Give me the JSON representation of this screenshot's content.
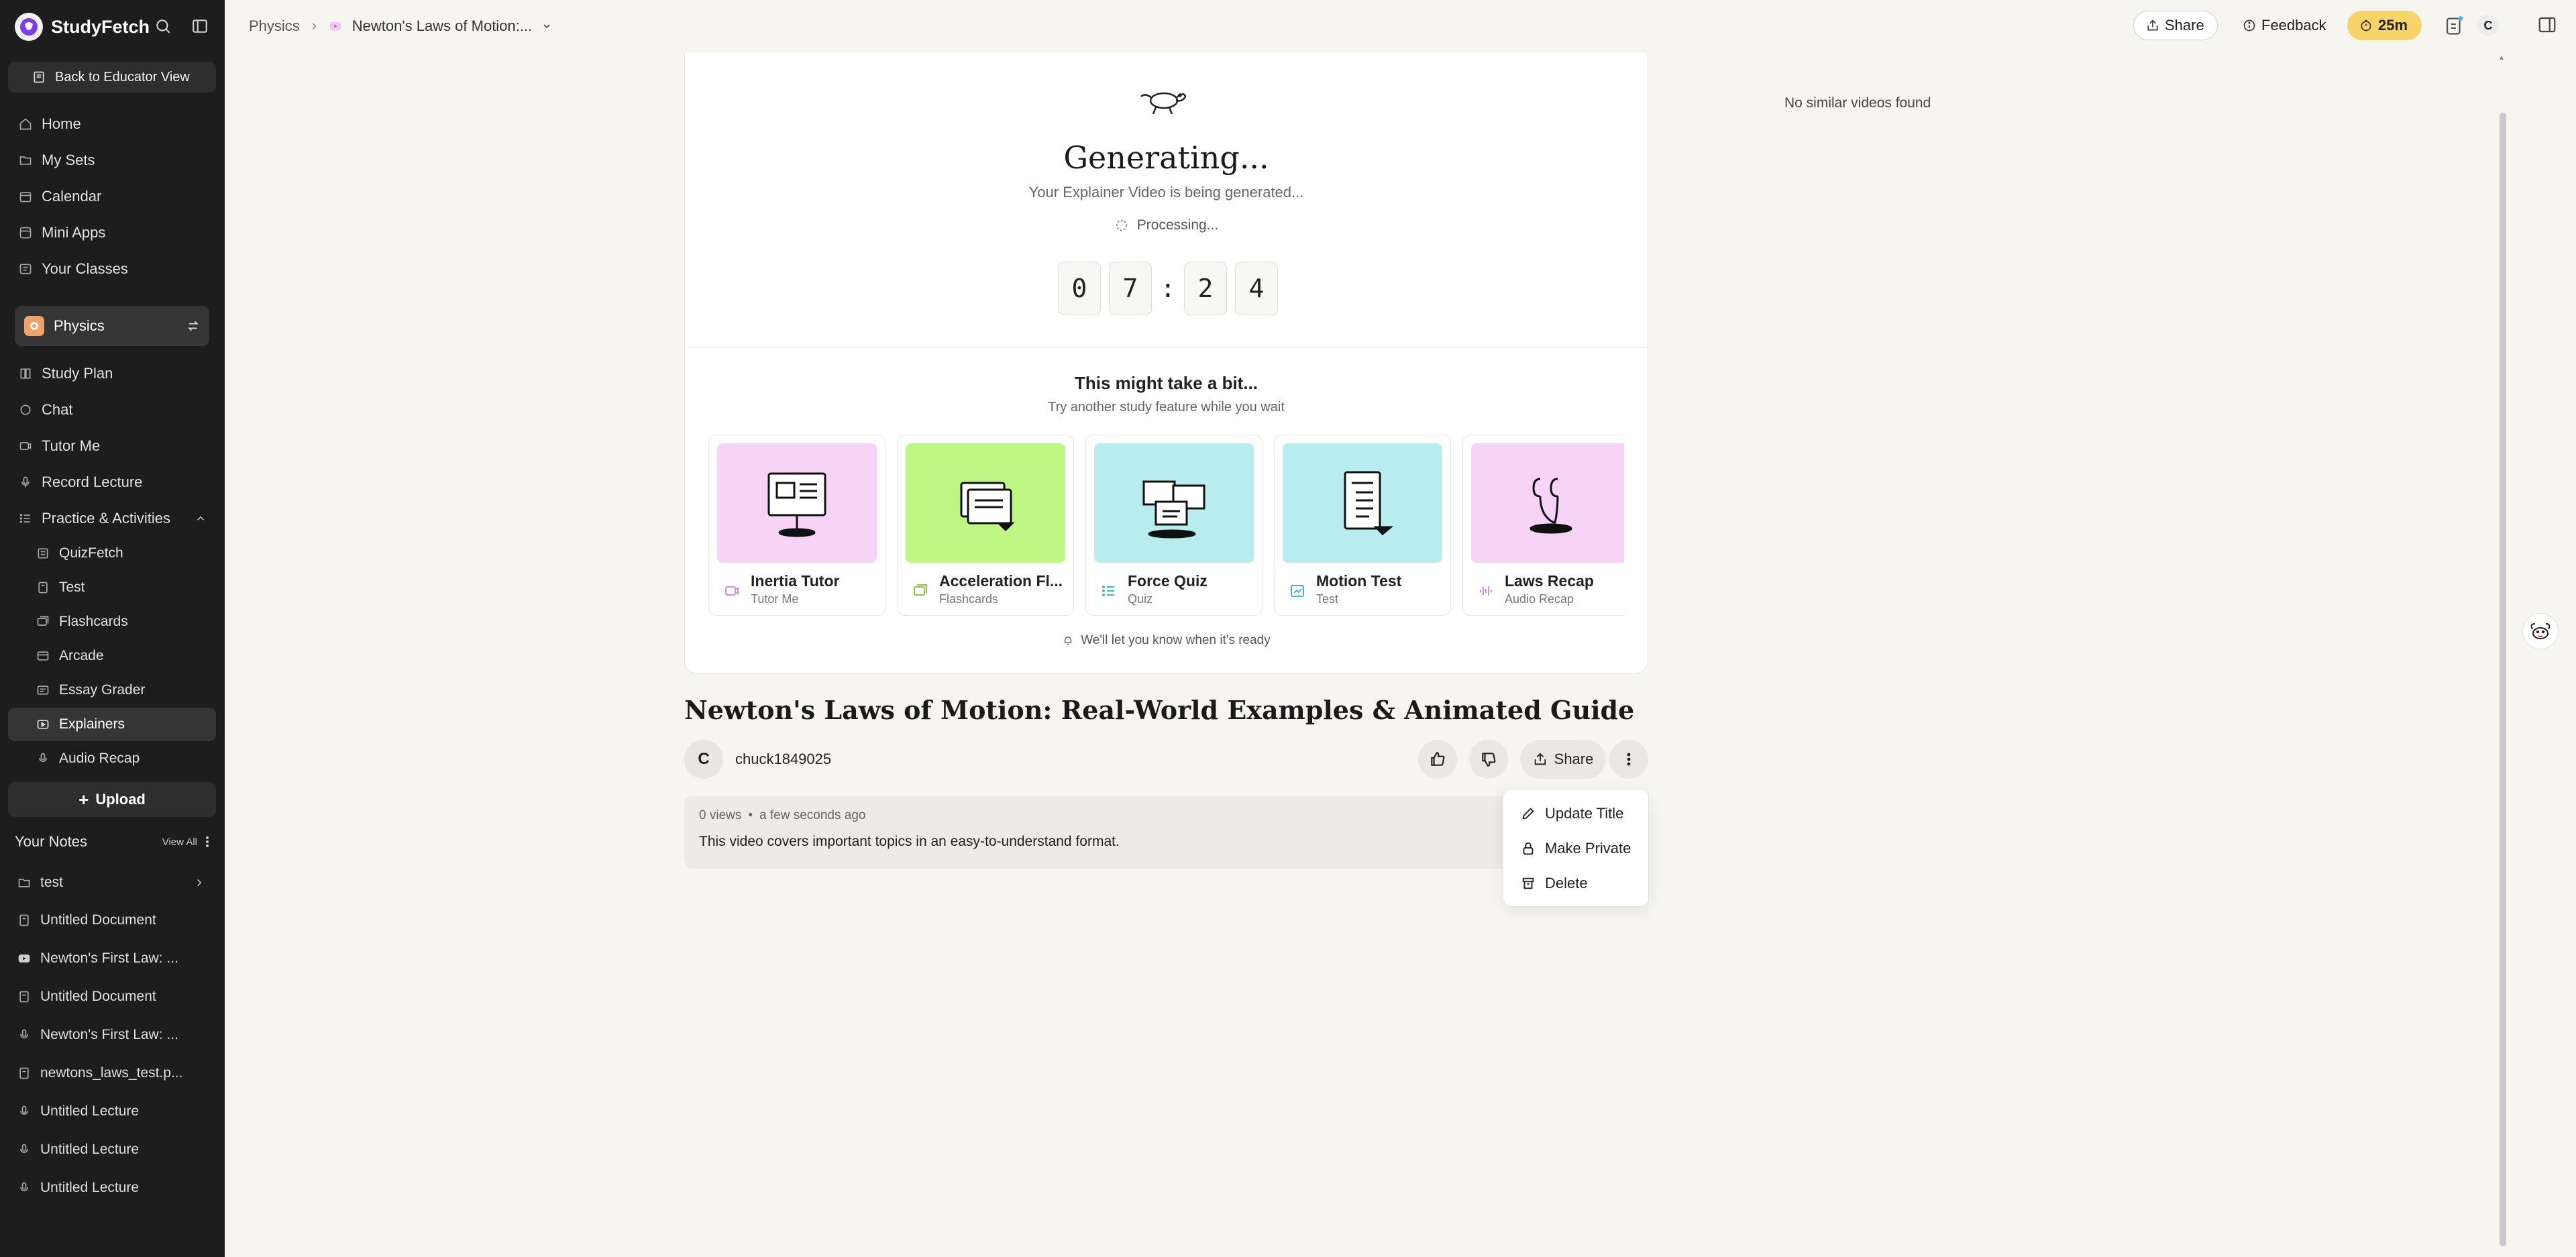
{
  "sidebar": {
    "brand": "StudyFetch",
    "educator_button": "Back to Educator View",
    "main_nav": [
      {
        "label": "Home",
        "icon": "home-icon"
      },
      {
        "label": "My Sets",
        "icon": "folder-icon"
      },
      {
        "label": "Calendar",
        "icon": "calendar-icon"
      },
      {
        "label": "Mini Apps",
        "icon": "apps-icon"
      },
      {
        "label": "Your Classes",
        "icon": "classes-icon"
      }
    ],
    "class_name": "Physics",
    "class_nav": [
      {
        "label": "Study Plan",
        "icon": "book-icon"
      },
      {
        "label": "Chat",
        "icon": "chat-icon"
      },
      {
        "label": "Tutor Me",
        "icon": "tutor-icon"
      },
      {
        "label": "Record Lecture",
        "icon": "mic-icon"
      },
      {
        "label": "Practice & Activities",
        "icon": "list-icon"
      }
    ],
    "activities": [
      {
        "label": "QuizFetch",
        "icon": "quiz-icon"
      },
      {
        "label": "Test",
        "icon": "test-icon"
      },
      {
        "label": "Flashcards",
        "icon": "cards-icon"
      },
      {
        "label": "Arcade",
        "icon": "arcade-icon"
      },
      {
        "label": "Essay Grader",
        "icon": "essay-icon"
      },
      {
        "label": "Explainers",
        "icon": "video-icon",
        "active": true
      },
      {
        "label": "Audio Recap",
        "icon": "mic-icon"
      }
    ],
    "upload_label": "Upload",
    "notes_header": "Your Notes",
    "view_all": "View All",
    "notes": [
      {
        "label": "test",
        "icon": "folder-icon",
        "chevron": true
      },
      {
        "label": "Untitled Document",
        "icon": "document-icon"
      },
      {
        "label": "Newton's First Law: ...",
        "icon": "youtube-icon"
      },
      {
        "label": "Untitled Document",
        "icon": "document-icon"
      },
      {
        "label": "Newton's First Law: ...",
        "icon": "mic-icon"
      },
      {
        "label": "newtons_laws_test.p...",
        "icon": "document-icon"
      },
      {
        "label": "Untitled Lecture",
        "icon": "mic-icon"
      },
      {
        "label": "Untitled Lecture",
        "icon": "mic-icon"
      },
      {
        "label": "Untitled Lecture",
        "icon": "mic-icon"
      }
    ]
  },
  "topbar": {
    "breadcrumb_root": "Physics",
    "breadcrumb_current": "Newton's Laws of Motion:...",
    "share_label": "Share",
    "feedback_label": "Feedback",
    "timer_label": "25m",
    "avatar_initial": "C"
  },
  "generation": {
    "title": "Generating...",
    "subtitle": "Your Explainer Video is being generated...",
    "status": "Processing...",
    "countdown": [
      "0",
      "7",
      ":",
      "2",
      "4"
    ],
    "wait_title": "This might take a bit...",
    "wait_subtitle": "Try another study feature while you wait",
    "notify": "We'll let you know when it's ready"
  },
  "features": [
    {
      "name": "Inertia Tutor",
      "type": "Tutor Me",
      "thumb_color": "#f6d3f7",
      "icon_color": "#d58be0"
    },
    {
      "name": "Acceleration Fl...",
      "type": "Flashcards",
      "thumb_color": "#bff784",
      "icon_color": "#8cc24a"
    },
    {
      "name": "Force Quiz",
      "type": "Quiz",
      "thumb_color": "#b8ecef",
      "icon_color": "#46b7c2"
    },
    {
      "name": "Motion Test",
      "type": "Test",
      "thumb_color": "#b8ecef",
      "icon_color": "#46b7c2"
    },
    {
      "name": "Laws Recap",
      "type": "Audio Recap",
      "thumb_color": "#f6d3f7",
      "icon_color": "#d58be0"
    }
  ],
  "video": {
    "title": "Newton's Laws of Motion: Real-World Examples & Animated Guide",
    "owner_initial": "C",
    "owner": "chuck1849025",
    "share_label": "Share",
    "views": "0 views",
    "time": "a few seconds ago",
    "description": "This video covers important topics in an easy-to-understand format."
  },
  "menu": {
    "items": [
      {
        "label": "Update Title",
        "icon": "pencil-icon"
      },
      {
        "label": "Make Private",
        "icon": "lock-icon"
      },
      {
        "label": "Delete",
        "icon": "trash-icon"
      }
    ]
  },
  "similar": {
    "empty": "No similar videos found"
  }
}
